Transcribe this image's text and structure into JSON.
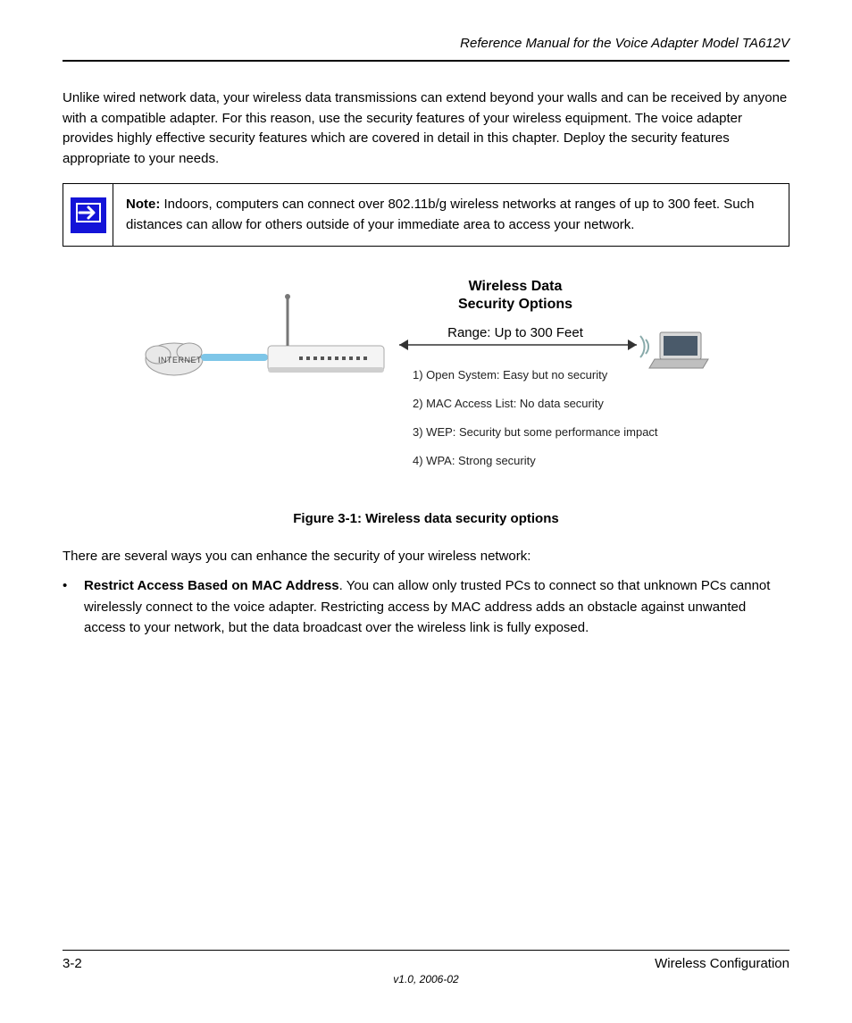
{
  "header": {
    "doc_title": "Reference Manual for the Voice Adapter Model TA612V"
  },
  "paragraphs": {
    "p1": "Unlike wired network data, your wireless data transmissions can extend beyond your walls and can be received by anyone with a compatible adapter. For this reason, use the security features of your wireless equipment. The voice adapter provides highly effective security features which are covered in detail in this chapter. Deploy the security features appropriate to your needs.",
    "p2": "There are several ways you can enhance the security of your wireless network:"
  },
  "note": {
    "label": "Note:",
    "text": " Indoors, computers can connect over 802.11b/g wireless networks at ranges of up to 300 feet. Such distances can allow for others outside of your immediate area to access your network."
  },
  "figure": {
    "title_line1": "Wireless Data",
    "title_line2": "Security Options",
    "range": "Range: Up to 300 Feet",
    "internet_label": "INTERNET",
    "options": {
      "o1": "1) Open System:  Easy but no security",
      "o2": "2) MAC Access List:  No data security",
      "o3": "3) WEP:  Security but some performance impact",
      "o4": "4) WPA:  Strong security"
    },
    "caption": "Figure 3-1:  Wireless data security options"
  },
  "bullet": {
    "lead_bold": "Restrict Access Based on MAC Address",
    "lead_rest": ". You can allow only trusted PCs to connect so that unknown PCs cannot wirelessly connect to the voice adapter. Restricting access by MAC address adds an obstacle against unwanted access to your network, but the data broadcast over the wireless link is fully exposed."
  },
  "footer": {
    "page": "3-2",
    "section": "Wireless Configuration",
    "version": "v1.0, 2006-02"
  }
}
